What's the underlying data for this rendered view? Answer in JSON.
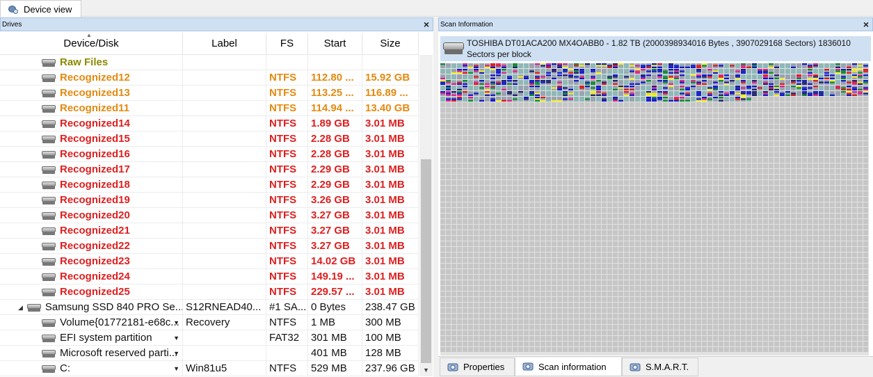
{
  "tabs": {
    "device_view": "Device view"
  },
  "drives_panel": {
    "title": "Drives",
    "close": "×",
    "columns": {
      "name": "Device/Disk",
      "label": "Label",
      "fs": "FS",
      "start": "Start",
      "size": "Size"
    },
    "rows": [
      {
        "name": "Raw Files",
        "label": "",
        "fs": "",
        "start": "",
        "size": "",
        "style": "olive"
      },
      {
        "name": "Recognized12",
        "label": "",
        "fs": "NTFS",
        "start": "112.80 ...",
        "size": "15.92 GB",
        "style": "orange"
      },
      {
        "name": "Recognized13",
        "label": "",
        "fs": "NTFS",
        "start": "113.25 ...",
        "size": "116.89 ...",
        "style": "orange"
      },
      {
        "name": "Recognized11",
        "label": "",
        "fs": "NTFS",
        "start": "114.94 ...",
        "size": "13.40 GB",
        "style": "orange"
      },
      {
        "name": "Recognized14",
        "label": "",
        "fs": "NTFS",
        "start": "1.89 GB",
        "size": "3.01 MB",
        "style": "red"
      },
      {
        "name": "Recognized15",
        "label": "",
        "fs": "NTFS",
        "start": "2.28 GB",
        "size": "3.01 MB",
        "style": "red"
      },
      {
        "name": "Recognized16",
        "label": "",
        "fs": "NTFS",
        "start": "2.28 GB",
        "size": "3.01 MB",
        "style": "red"
      },
      {
        "name": "Recognized17",
        "label": "",
        "fs": "NTFS",
        "start": "2.29 GB",
        "size": "3.01 MB",
        "style": "red"
      },
      {
        "name": "Recognized18",
        "label": "",
        "fs": "NTFS",
        "start": "2.29 GB",
        "size": "3.01 MB",
        "style": "red"
      },
      {
        "name": "Recognized19",
        "label": "",
        "fs": "NTFS",
        "start": "3.26 GB",
        "size": "3.01 MB",
        "style": "red"
      },
      {
        "name": "Recognized20",
        "label": "",
        "fs": "NTFS",
        "start": "3.27 GB",
        "size": "3.01 MB",
        "style": "red"
      },
      {
        "name": "Recognized21",
        "label": "",
        "fs": "NTFS",
        "start": "3.27 GB",
        "size": "3.01 MB",
        "style": "red"
      },
      {
        "name": "Recognized22",
        "label": "",
        "fs": "NTFS",
        "start": "3.27 GB",
        "size": "3.01 MB",
        "style": "red"
      },
      {
        "name": "Recognized23",
        "label": "",
        "fs": "NTFS",
        "start": "14.02 GB",
        "size": "3.01 MB",
        "style": "red"
      },
      {
        "name": "Recognized24",
        "label": "",
        "fs": "NTFS",
        "start": "149.19 ...",
        "size": "3.01 MB",
        "style": "red"
      },
      {
        "name": "Recognized25",
        "label": "",
        "fs": "NTFS",
        "start": "229.57 ...",
        "size": "3.01 MB",
        "style": "red"
      },
      {
        "name": "Samsung SSD 840 PRO Se...",
        "label": "S12RNEAD40...",
        "fs": "#1 SA...",
        "start": "0 Bytes",
        "size": "238.47 GB",
        "style": "plain",
        "expandable": true
      },
      {
        "name": "Volume{01772181-e68c...",
        "label": "Recovery",
        "fs": "NTFS",
        "start": "1 MB",
        "size": "300 MB",
        "style": "plain",
        "dropdown": true
      },
      {
        "name": "EFI system partition",
        "label": "",
        "fs": "FAT32",
        "start": "301 MB",
        "size": "100 MB",
        "style": "plain",
        "dropdown": true
      },
      {
        "name": "Microsoft reserved parti...",
        "label": "",
        "fs": "",
        "start": "401 MB",
        "size": "128 MB",
        "style": "plain",
        "dropdown": true
      },
      {
        "name": "C:",
        "label": "Win81u5",
        "fs": "NTFS",
        "start": "529 MB",
        "size": "237.96 GB",
        "style": "plain",
        "dropdown": true
      }
    ]
  },
  "scan_panel": {
    "title": "Scan Information",
    "close": "×",
    "disk_info": [
      "TOSHIBA DT01ACA200 MX4OABB0 - 1.82 TB (2000398934016 Bytes , 3907029168 Sectors) 1836010",
      "Sectors per block"
    ],
    "colors": {
      "empty": "#c6c6c6",
      "blue": "#1018c8",
      "magenta": "#e0228a",
      "green": "#0a8a2a",
      "yellow": "#f2ef1a",
      "teal": "#8fb8b8",
      "navy": "#1d1f6e",
      "red": "#e01818"
    },
    "bottom_tabs": [
      {
        "label": "Properties",
        "icon": "properties-icon",
        "active": false
      },
      {
        "label": "Scan information",
        "icon": "scan-information-icon",
        "active": true
      },
      {
        "label": "S.M.A.R.T.",
        "icon": "smart-icon",
        "active": false
      }
    ]
  }
}
